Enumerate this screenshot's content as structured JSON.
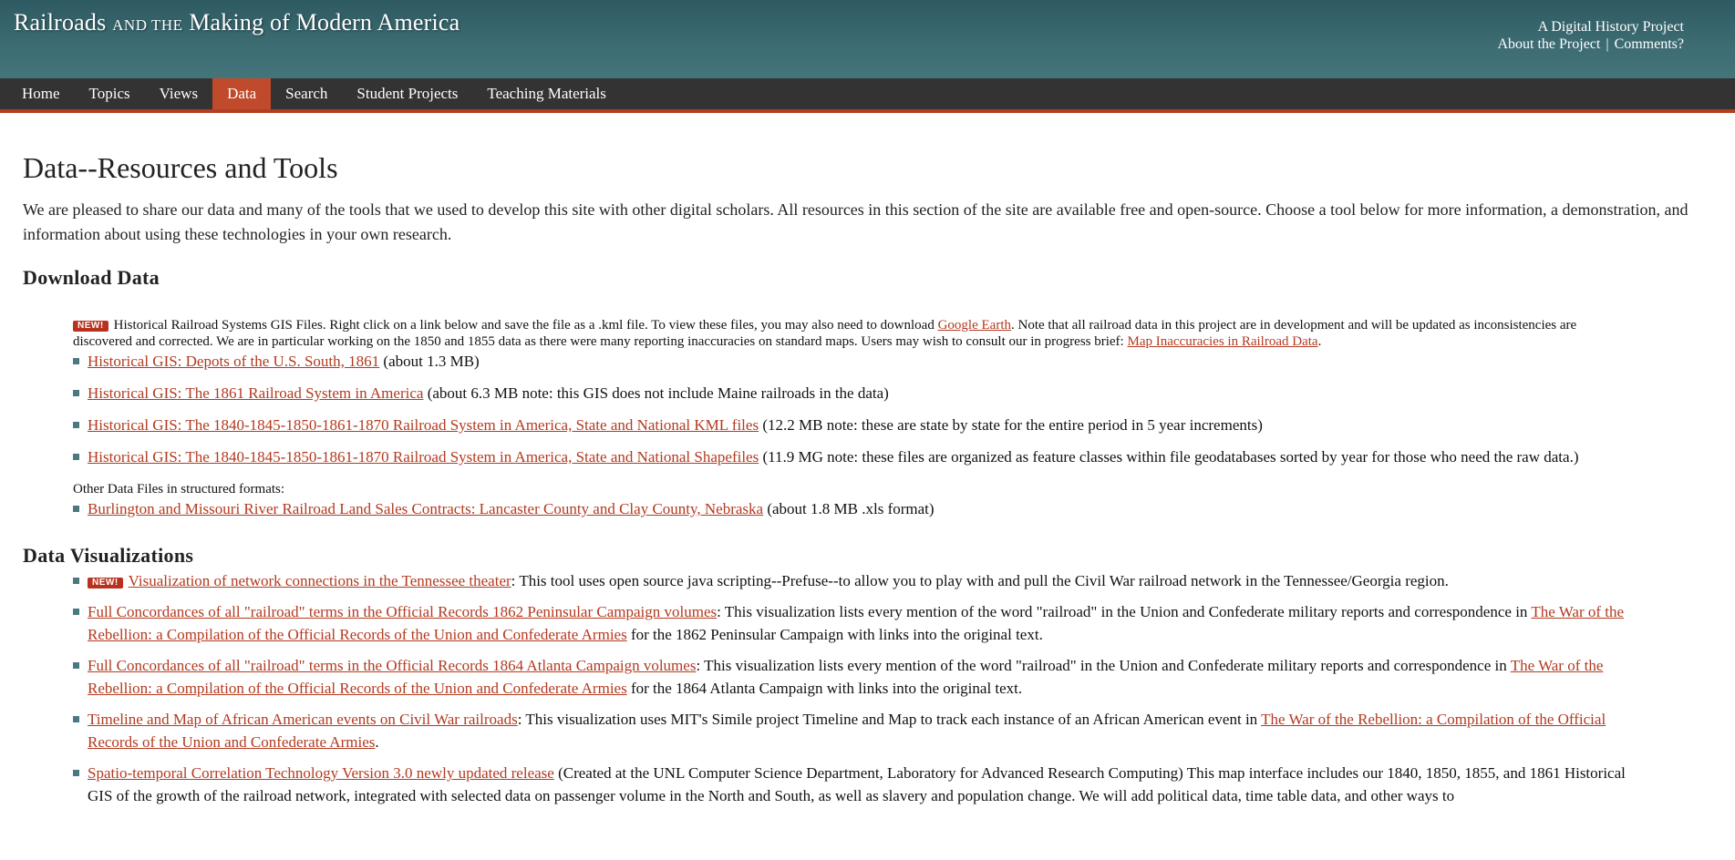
{
  "header": {
    "title_part1": "Railroads",
    "title_and": "and the",
    "title_part2": "Making of Modern America",
    "tagline": "A Digital History Project",
    "about_link": "About the Project",
    "separator": "|",
    "comments_link": "Comments?"
  },
  "nav": {
    "items": [
      {
        "label": "Home"
      },
      {
        "label": "Topics"
      },
      {
        "label": "Views"
      },
      {
        "label": "Data"
      },
      {
        "label": "Search"
      },
      {
        "label": "Student Projects"
      },
      {
        "label": "Teaching Materials"
      }
    ],
    "active": "Data"
  },
  "page": {
    "title": "Data--Resources and Tools",
    "intro": "We are pleased to share our data and many of the tools that we used to develop this site with other digital scholars. All resources in this section of the site are available free and open-source. Choose a tool below for more information, a demonstration, and information about using these technologies in your own research."
  },
  "download": {
    "heading": "Download Data",
    "badge": "NEW!",
    "note_text1": "Historical Railroad Systems GIS Files. Right click on a link below and save the file as a .kml file. To view these files, you may also need to download ",
    "note_link1": "Google Earth",
    "note_text2": ". Note that all railroad data in this project are in development and will be updated as inconsistencies are discovered and corrected. We are in particular working on the 1850 and 1855 data as there were many reporting inaccuracies on standard maps. Users may wish to consult our in progress brief: ",
    "note_link2": "Map Inaccuracies in Railroad Data",
    "note_text3": ".",
    "items": [
      {
        "link": "Historical GIS: Depots of the U.S. South, 1861",
        "desc": " (about 1.3 MB)"
      },
      {
        "link": "Historical GIS: The 1861 Railroad System in America",
        "desc": " (about 6.3 MB note: this GIS does not include Maine railroads in the data)"
      },
      {
        "link": "Historical GIS: The 1840-1845-1850-1861-1870 Railroad System in America, State and National KML files",
        "desc": " (12.2 MB note: these are state by state for the entire period in 5 year increments)"
      },
      {
        "link": "Historical GIS: The 1840-1845-1850-1861-1870 Railroad System in America, State and National Shapefiles",
        "desc": " (11.9 MG note: these files are organized as feature classes within file geodatabases sorted by year for those who need the raw data.)"
      }
    ],
    "other_label": "Other Data Files in structured formats:",
    "other_items": [
      {
        "link": "Burlington and Missouri River Railroad Land Sales Contracts: Lancaster County and Clay County, Nebraska",
        "desc": " (about 1.8 MB .xls format)"
      }
    ]
  },
  "viz": {
    "heading": "Data Visualizations",
    "badge": "NEW!",
    "items": [
      {
        "link": "Visualization of network connections in the Tennessee theater",
        "desc": ": This tool uses open source java scripting--Prefuse--to allow you to play with and pull the Civil War railroad network in the Tennessee/Georgia region."
      },
      {
        "link": "Full Concordances of all \"railroad\" terms in the Official Records 1862 Peninsular Campaign volumes",
        "desc": ": This visualization lists every mention of the word \"railroad\" in the Union and Confederate military reports and correspondence in ",
        "link2": "The War of the Rebellion: a Compilation of the Official Records of the Union and Confederate Armies",
        "desc2": " for the 1862 Peninsular Campaign with links into the original text."
      },
      {
        "link": "Full Concordances of all \"railroad\" terms in the Official Records 1864 Atlanta Campaign volumes",
        "desc": ": This visualization lists every mention of the word \"railroad\" in the Union and Confederate military reports and correspondence in ",
        "link2": "The War of the Rebellion: a Compilation of the Official Records of the Union and Confederate Armies",
        "desc2": " for the 1864 Atlanta Campaign with links into the original text."
      },
      {
        "link": "Timeline and Map of African American events on Civil War railroads",
        "desc": ": This visualization uses MIT's Simile project Timeline and Map to track each instance of an African American event in ",
        "link2": "The War of the Rebellion: a Compilation of the Official Records of the Union and Confederate Armies",
        "desc2": "."
      },
      {
        "link": "Spatio-temporal Correlation Technology Version 3.0 newly updated release",
        "desc": " (Created at the UNL Computer Science Department, Laboratory for Advanced Research Computing) This map interface includes our 1840, 1850, 1855, and 1861 Historical GIS of the growth of the railroad network, integrated with selected data on passenger volume in the North and South, as well as slavery and population change. We will add political data, time table data, and other ways to"
      }
    ]
  }
}
